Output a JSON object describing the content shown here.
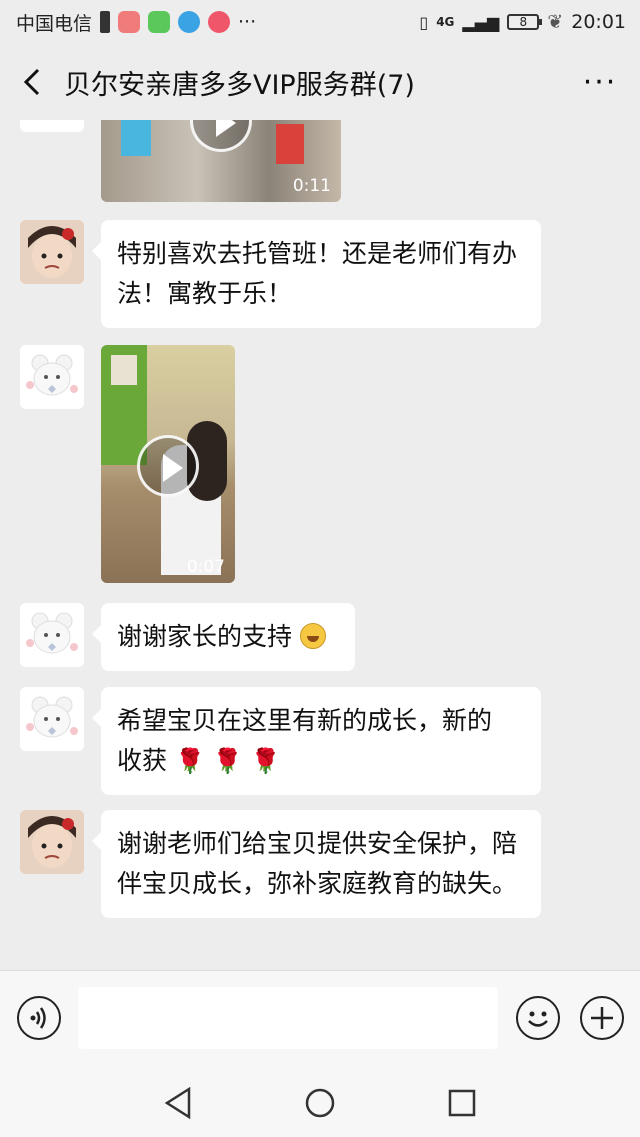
{
  "status_bar": {
    "carrier": "中国电信",
    "network": "4G",
    "battery": "8",
    "time": "20:01"
  },
  "header": {
    "title": "贝尔安亲唐多多VIP服务群(7)"
  },
  "messages": [
    {
      "type": "video",
      "duration": "0:11"
    },
    {
      "type": "text",
      "text": "特别喜欢去托管班！还是老师们有办法！寓教于乐！"
    },
    {
      "type": "video",
      "duration": "0:07"
    },
    {
      "type": "text",
      "text": "谢谢家长的支持"
    },
    {
      "type": "text",
      "line1": "希望宝贝在这里有新的成长，新的",
      "line2": "收获"
    },
    {
      "type": "text",
      "text": "谢谢老师们给宝贝提供安全保护，陪伴宝贝成长，弥补家庭教育的缺失。"
    }
  ],
  "icons": {
    "back": "back-arrow-icon",
    "more": "more-icon",
    "voice": "voice-icon",
    "emoji": "emoji-icon",
    "plus": "plus-icon"
  }
}
